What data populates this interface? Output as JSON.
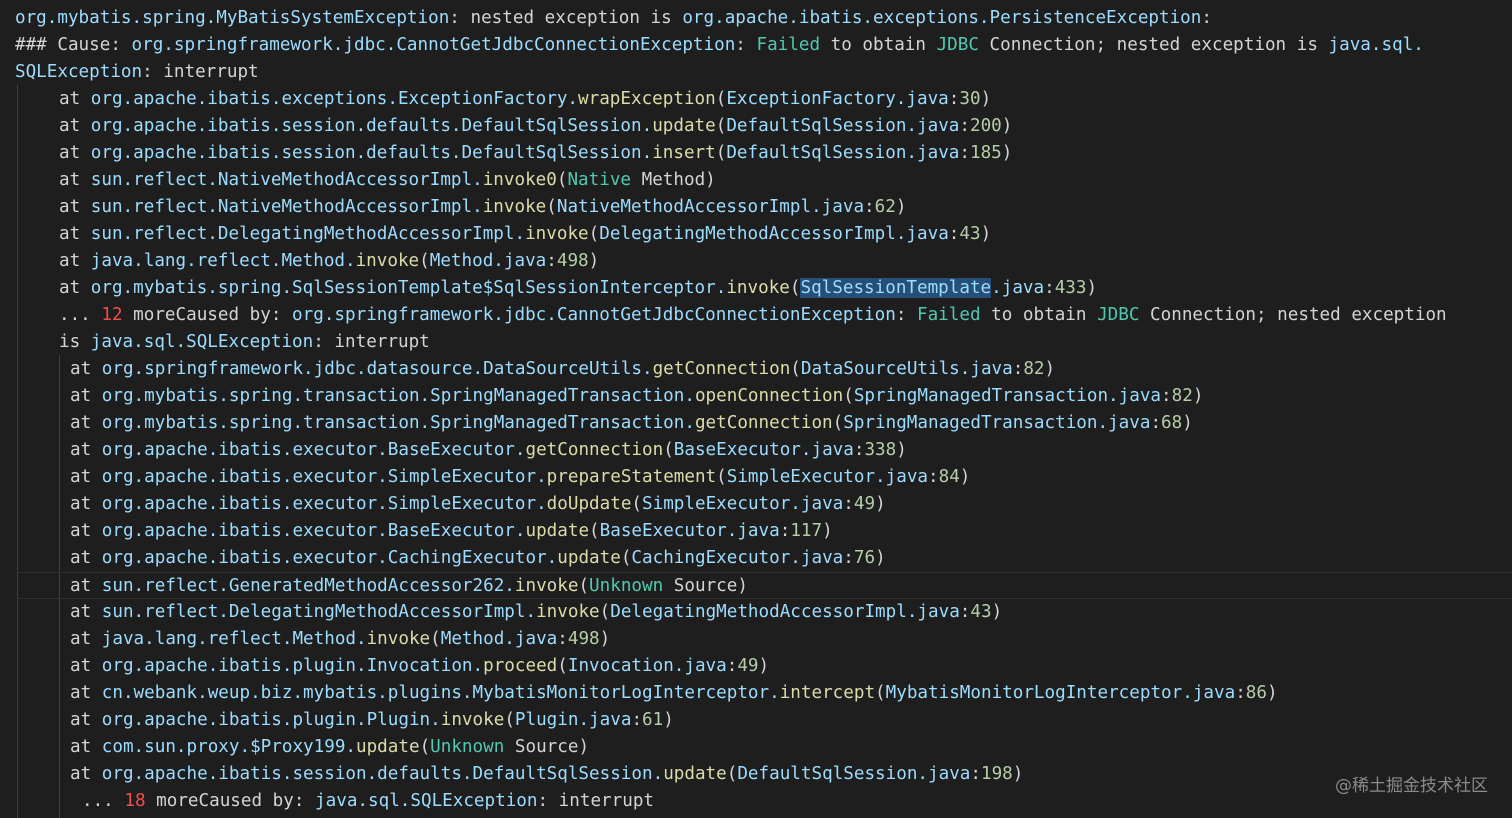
{
  "lines": [
    {
      "indent": 15,
      "segments": [
        {
          "t": "org.mybatis.spring.MyBatisSystemException",
          "c": "cls"
        },
        {
          "t": ": nested exception is ",
          "c": "def"
        },
        {
          "t": "org.apache.ibatis.exceptions.PersistenceException",
          "c": "cls"
        },
        {
          "t": ":",
          "c": "def"
        }
      ]
    },
    {
      "indent": 15,
      "segments": [
        {
          "t": "### Cause: ",
          "c": "def"
        },
        {
          "t": "org.springframework.jdbc.CannotGetJdbcConnectionException",
          "c": "cls"
        },
        {
          "t": ": ",
          "c": "def"
        },
        {
          "t": "Failed",
          "c": "kw"
        },
        {
          "t": " to obtain ",
          "c": "def"
        },
        {
          "t": "JDBC",
          "c": "jdbc"
        },
        {
          "t": " Connection; nested exception is ",
          "c": "def"
        },
        {
          "t": "java.sql.",
          "c": "cls"
        }
      ]
    },
    {
      "indent": 15,
      "segments": [
        {
          "t": "SQLException",
          "c": "cls"
        },
        {
          "t": ": interrupt",
          "c": "def"
        }
      ]
    },
    {
      "indent": 59,
      "segments": [
        {
          "t": "at ",
          "c": "def"
        },
        {
          "t": "org.apache.ibatis.exceptions.ExceptionFactory.",
          "c": "cls"
        },
        {
          "t": "wrapException",
          "c": "fn"
        },
        {
          "t": "(",
          "c": "def"
        },
        {
          "t": "ExceptionFactory.java",
          "c": "cls"
        },
        {
          "t": ":",
          "c": "def"
        },
        {
          "t": "30",
          "c": "num"
        },
        {
          "t": ")",
          "c": "def"
        }
      ]
    },
    {
      "indent": 59,
      "segments": [
        {
          "t": "at ",
          "c": "def"
        },
        {
          "t": "org.apache.ibatis.session.defaults.DefaultSqlSession.",
          "c": "cls"
        },
        {
          "t": "update",
          "c": "fn"
        },
        {
          "t": "(",
          "c": "def"
        },
        {
          "t": "DefaultSqlSession.java",
          "c": "cls"
        },
        {
          "t": ":",
          "c": "def"
        },
        {
          "t": "200",
          "c": "num"
        },
        {
          "t": ")",
          "c": "def"
        }
      ]
    },
    {
      "indent": 59,
      "segments": [
        {
          "t": "at ",
          "c": "def"
        },
        {
          "t": "org.apache.ibatis.session.defaults.DefaultSqlSession.",
          "c": "cls"
        },
        {
          "t": "insert",
          "c": "fn"
        },
        {
          "t": "(",
          "c": "def"
        },
        {
          "t": "DefaultSqlSession.java",
          "c": "cls"
        },
        {
          "t": ":",
          "c": "def"
        },
        {
          "t": "185",
          "c": "num"
        },
        {
          "t": ")",
          "c": "def"
        }
      ]
    },
    {
      "indent": 59,
      "segments": [
        {
          "t": "at ",
          "c": "def"
        },
        {
          "t": "sun.reflect.NativeMethodAccessorImpl.",
          "c": "cls"
        },
        {
          "t": "invoke0",
          "c": "fn"
        },
        {
          "t": "(",
          "c": "def"
        },
        {
          "t": "Native",
          "c": "kw"
        },
        {
          "t": " Method)",
          "c": "def"
        }
      ]
    },
    {
      "indent": 59,
      "segments": [
        {
          "t": "at ",
          "c": "def"
        },
        {
          "t": "sun.reflect.NativeMethodAccessorImpl.",
          "c": "cls"
        },
        {
          "t": "invoke",
          "c": "fn"
        },
        {
          "t": "(",
          "c": "def"
        },
        {
          "t": "NativeMethodAccessorImpl.java",
          "c": "cls"
        },
        {
          "t": ":",
          "c": "def"
        },
        {
          "t": "62",
          "c": "num"
        },
        {
          "t": ")",
          "c": "def"
        }
      ]
    },
    {
      "indent": 59,
      "segments": [
        {
          "t": "at ",
          "c": "def"
        },
        {
          "t": "sun.reflect.DelegatingMethodAccessorImpl.",
          "c": "cls"
        },
        {
          "t": "invoke",
          "c": "fn"
        },
        {
          "t": "(",
          "c": "def"
        },
        {
          "t": "DelegatingMethodAccessorImpl.java",
          "c": "cls"
        },
        {
          "t": ":",
          "c": "def"
        },
        {
          "t": "43",
          "c": "num"
        },
        {
          "t": ")",
          "c": "def"
        }
      ]
    },
    {
      "indent": 59,
      "segments": [
        {
          "t": "at ",
          "c": "def"
        },
        {
          "t": "java.lang.reflect.Method.",
          "c": "cls"
        },
        {
          "t": "invoke",
          "c": "fn"
        },
        {
          "t": "(",
          "c": "def"
        },
        {
          "t": "Method.java",
          "c": "cls"
        },
        {
          "t": ":",
          "c": "def"
        },
        {
          "t": "498",
          "c": "num"
        },
        {
          "t": ")",
          "c": "def"
        }
      ]
    },
    {
      "indent": 59,
      "segments": [
        {
          "t": "at ",
          "c": "def"
        },
        {
          "t": "org.mybatis.spring.SqlSessionTemplate$SqlSessionInterceptor.",
          "c": "cls"
        },
        {
          "t": "invoke",
          "c": "fn"
        },
        {
          "t": "(",
          "c": "def"
        },
        {
          "t": "SqlSessionTemplate",
          "c": "cls",
          "sel": true
        },
        {
          "t": ".java",
          "c": "cls"
        },
        {
          "t": ":",
          "c": "def"
        },
        {
          "t": "433",
          "c": "num"
        },
        {
          "t": ")",
          "c": "def"
        }
      ]
    },
    {
      "indent": 59,
      "segments": [
        {
          "t": "... ",
          "c": "def"
        },
        {
          "t": "12",
          "c": "red"
        },
        {
          "t": " moreCaused by: ",
          "c": "def"
        },
        {
          "t": "org.springframework.jdbc.CannotGetJdbcConnectionException",
          "c": "cls"
        },
        {
          "t": ": ",
          "c": "def"
        },
        {
          "t": "Failed",
          "c": "kw"
        },
        {
          "t": " to obtain ",
          "c": "def"
        },
        {
          "t": "JDBC",
          "c": "jdbc"
        },
        {
          "t": " Connection; nested exception",
          "c": "def"
        }
      ]
    },
    {
      "indent": 59,
      "segments": [
        {
          "t": "is ",
          "c": "def"
        },
        {
          "t": "java.sql.SQLException",
          "c": "cls"
        },
        {
          "t": ": interrupt",
          "c": "def"
        }
      ]
    },
    {
      "indent": 70,
      "segments": [
        {
          "t": "at ",
          "c": "def"
        },
        {
          "t": "org.springframework.jdbc.datasource.DataSourceUtils.",
          "c": "cls"
        },
        {
          "t": "getConnection",
          "c": "fn"
        },
        {
          "t": "(",
          "c": "def"
        },
        {
          "t": "DataSourceUtils.java",
          "c": "cls"
        },
        {
          "t": ":",
          "c": "def"
        },
        {
          "t": "82",
          "c": "num"
        },
        {
          "t": ")",
          "c": "def"
        }
      ]
    },
    {
      "indent": 70,
      "segments": [
        {
          "t": "at ",
          "c": "def"
        },
        {
          "t": "org.mybatis.spring.transaction.SpringManagedTransaction.",
          "c": "cls"
        },
        {
          "t": "openConnection",
          "c": "fn"
        },
        {
          "t": "(",
          "c": "def"
        },
        {
          "t": "SpringManagedTransaction.java",
          "c": "cls"
        },
        {
          "t": ":",
          "c": "def"
        },
        {
          "t": "82",
          "c": "num"
        },
        {
          "t": ")",
          "c": "def"
        }
      ]
    },
    {
      "indent": 70,
      "segments": [
        {
          "t": "at ",
          "c": "def"
        },
        {
          "t": "org.mybatis.spring.transaction.SpringManagedTransaction.",
          "c": "cls"
        },
        {
          "t": "getConnection",
          "c": "fn"
        },
        {
          "t": "(",
          "c": "def"
        },
        {
          "t": "SpringManagedTransaction.java",
          "c": "cls"
        },
        {
          "t": ":",
          "c": "def"
        },
        {
          "t": "68",
          "c": "num"
        },
        {
          "t": ")",
          "c": "def"
        }
      ]
    },
    {
      "indent": 70,
      "segments": [
        {
          "t": "at ",
          "c": "def"
        },
        {
          "t": "org.apache.ibatis.executor.BaseExecutor.",
          "c": "cls"
        },
        {
          "t": "getConnection",
          "c": "fn"
        },
        {
          "t": "(",
          "c": "def"
        },
        {
          "t": "BaseExecutor.java",
          "c": "cls"
        },
        {
          "t": ":",
          "c": "def"
        },
        {
          "t": "338",
          "c": "num"
        },
        {
          "t": ")",
          "c": "def"
        }
      ]
    },
    {
      "indent": 70,
      "segments": [
        {
          "t": "at ",
          "c": "def"
        },
        {
          "t": "org.apache.ibatis.executor.SimpleExecutor.",
          "c": "cls"
        },
        {
          "t": "prepareStatement",
          "c": "fn"
        },
        {
          "t": "(",
          "c": "def"
        },
        {
          "t": "SimpleExecutor.java",
          "c": "cls"
        },
        {
          "t": ":",
          "c": "def"
        },
        {
          "t": "84",
          "c": "num"
        },
        {
          "t": ")",
          "c": "def"
        }
      ]
    },
    {
      "indent": 70,
      "segments": [
        {
          "t": "at ",
          "c": "def"
        },
        {
          "t": "org.apache.ibatis.executor.SimpleExecutor.",
          "c": "cls"
        },
        {
          "t": "doUpdate",
          "c": "fn"
        },
        {
          "t": "(",
          "c": "def"
        },
        {
          "t": "SimpleExecutor.java",
          "c": "cls"
        },
        {
          "t": ":",
          "c": "def"
        },
        {
          "t": "49",
          "c": "num"
        },
        {
          "t": ")",
          "c": "def"
        }
      ]
    },
    {
      "indent": 70,
      "segments": [
        {
          "t": "at ",
          "c": "def"
        },
        {
          "t": "org.apache.ibatis.executor.BaseExecutor.",
          "c": "cls"
        },
        {
          "t": "update",
          "c": "fn"
        },
        {
          "t": "(",
          "c": "def"
        },
        {
          "t": "BaseExecutor.java",
          "c": "cls"
        },
        {
          "t": ":",
          "c": "def"
        },
        {
          "t": "117",
          "c": "num"
        },
        {
          "t": ")",
          "c": "def"
        }
      ]
    },
    {
      "indent": 70,
      "segments": [
        {
          "t": "at ",
          "c": "def"
        },
        {
          "t": "org.apache.ibatis.executor.CachingExecutor.",
          "c": "cls"
        },
        {
          "t": "update",
          "c": "fn"
        },
        {
          "t": "(",
          "c": "def"
        },
        {
          "t": "CachingExecutor.java",
          "c": "cls"
        },
        {
          "t": ":",
          "c": "def"
        },
        {
          "t": "76",
          "c": "num"
        },
        {
          "t": ")",
          "c": "def"
        }
      ]
    },
    {
      "indent": 70,
      "highlight": true,
      "segments": [
        {
          "t": "at ",
          "c": "def"
        },
        {
          "t": "sun.reflect.GeneratedMethodAccessor262.",
          "c": "cls"
        },
        {
          "t": "invoke",
          "c": "fn"
        },
        {
          "t": "(",
          "c": "def"
        },
        {
          "t": "Unknown",
          "c": "kw"
        },
        {
          "t": " Source)",
          "c": "def"
        }
      ]
    },
    {
      "indent": 70,
      "segments": [
        {
          "t": "at ",
          "c": "def"
        },
        {
          "t": "sun.reflect.DelegatingMethodAccessorImpl.",
          "c": "cls"
        },
        {
          "t": "invoke",
          "c": "fn"
        },
        {
          "t": "(",
          "c": "def"
        },
        {
          "t": "DelegatingMethodAccessorImpl.java",
          "c": "cls"
        },
        {
          "t": ":",
          "c": "def"
        },
        {
          "t": "43",
          "c": "num"
        },
        {
          "t": ")",
          "c": "def"
        }
      ]
    },
    {
      "indent": 70,
      "segments": [
        {
          "t": "at ",
          "c": "def"
        },
        {
          "t": "java.lang.reflect.Method.",
          "c": "cls"
        },
        {
          "t": "invoke",
          "c": "fn"
        },
        {
          "t": "(",
          "c": "def"
        },
        {
          "t": "Method.java",
          "c": "cls"
        },
        {
          "t": ":",
          "c": "def"
        },
        {
          "t": "498",
          "c": "num"
        },
        {
          "t": ")",
          "c": "def"
        }
      ]
    },
    {
      "indent": 70,
      "segments": [
        {
          "t": "at ",
          "c": "def"
        },
        {
          "t": "org.apache.ibatis.plugin.Invocation.",
          "c": "cls"
        },
        {
          "t": "proceed",
          "c": "fn"
        },
        {
          "t": "(",
          "c": "def"
        },
        {
          "t": "Invocation.java",
          "c": "cls"
        },
        {
          "t": ":",
          "c": "def"
        },
        {
          "t": "49",
          "c": "num"
        },
        {
          "t": ")",
          "c": "def"
        }
      ]
    },
    {
      "indent": 70,
      "segments": [
        {
          "t": "at ",
          "c": "def"
        },
        {
          "t": "cn.webank.weup.biz.mybatis.plugins.MybatisMonitorLogInterceptor.",
          "c": "cls"
        },
        {
          "t": "intercept",
          "c": "fn"
        },
        {
          "t": "(",
          "c": "def"
        },
        {
          "t": "MybatisMonitorLogInterceptor.java",
          "c": "cls"
        },
        {
          "t": ":",
          "c": "def"
        },
        {
          "t": "86",
          "c": "num"
        },
        {
          "t": ")",
          "c": "def"
        }
      ]
    },
    {
      "indent": 70,
      "segments": [
        {
          "t": "at ",
          "c": "def"
        },
        {
          "t": "org.apache.ibatis.plugin.Plugin.",
          "c": "cls"
        },
        {
          "t": "invoke",
          "c": "fn"
        },
        {
          "t": "(",
          "c": "def"
        },
        {
          "t": "Plugin.java",
          "c": "cls"
        },
        {
          "t": ":",
          "c": "def"
        },
        {
          "t": "61",
          "c": "num"
        },
        {
          "t": ")",
          "c": "def"
        }
      ]
    },
    {
      "indent": 70,
      "segments": [
        {
          "t": "at ",
          "c": "def"
        },
        {
          "t": "com.sun.proxy.$Proxy199.",
          "c": "cls"
        },
        {
          "t": "update",
          "c": "fn"
        },
        {
          "t": "(",
          "c": "def"
        },
        {
          "t": "Unknown",
          "c": "kw"
        },
        {
          "t": " Source)",
          "c": "def"
        }
      ]
    },
    {
      "indent": 70,
      "segments": [
        {
          "t": "at ",
          "c": "def"
        },
        {
          "t": "org.apache.ibatis.session.defaults.DefaultSqlSession.",
          "c": "cls"
        },
        {
          "t": "update",
          "c": "fn"
        },
        {
          "t": "(",
          "c": "def"
        },
        {
          "t": "DefaultSqlSession.java",
          "c": "cls"
        },
        {
          "t": ":",
          "c": "def"
        },
        {
          "t": "198",
          "c": "num"
        },
        {
          "t": ")",
          "c": "def"
        }
      ]
    },
    {
      "indent": 82,
      "segments": [
        {
          "t": "... ",
          "c": "def"
        },
        {
          "t": "18",
          "c": "red"
        },
        {
          "t": " moreCaused by: ",
          "c": "def"
        },
        {
          "t": "java.sql.SQLException",
          "c": "cls"
        },
        {
          "t": ": interrupt",
          "c": "def"
        }
      ]
    }
  ],
  "watermark": "@稀土掘金技术社区"
}
